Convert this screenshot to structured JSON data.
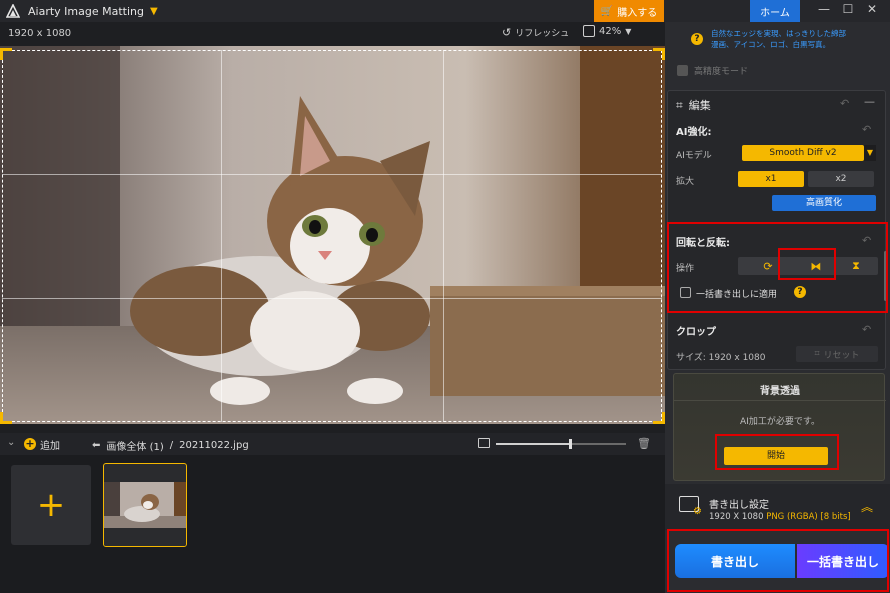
{
  "titlebar": {
    "app_name": "Aiarty Image Matting",
    "buy_label": "購入する",
    "home_label": "ホーム"
  },
  "viewer": {
    "resolution": "1920 x 1080",
    "refresh_label": "リフレッシュ",
    "zoom_level": "42%"
  },
  "filmstrip": {
    "add_label": "追加",
    "breadcrumb_all": "画像全体 (1)",
    "separator": "/",
    "filename": "20211022.jpg",
    "zoom_slider_value": 0.57
  },
  "panel": {
    "tip_line1": "自然なエッジを実現、はっきりした綿部",
    "tip_line2": "漫画、アイコン、ロゴ、白黒写真。",
    "hq_mode_label": "高精度モード",
    "edit": {
      "title": "編集",
      "ai_section": "AI強化:",
      "ai_model_label": "AIモデル",
      "ai_model_value": "Smooth Diff v2",
      "scale_label": "拡大",
      "scale_x1": "x1",
      "scale_x2": "x2",
      "upscale_button": "高画質化",
      "rotate_section": "回転と反転:",
      "operation_label": "操作",
      "batch_apply_label": "一括書き出しに適用",
      "crop_section": "クロップ",
      "size_label": "サイズ: 1920 x 1080",
      "reset_label": "リセット"
    },
    "background": {
      "title": "背景透過",
      "note": "AI加工が必要です。",
      "start_button": "開始"
    },
    "export": {
      "title": "書き出し設定",
      "resolution": "1920 X 1080",
      "format": "PNG (RGBA) [8 bits]"
    },
    "buttons": {
      "export": "書き出し",
      "batch_export": "一括書き出し"
    }
  },
  "colors": {
    "accent": "#f5b800",
    "blue": "#1f6fd6",
    "highlight": "#e00000"
  }
}
